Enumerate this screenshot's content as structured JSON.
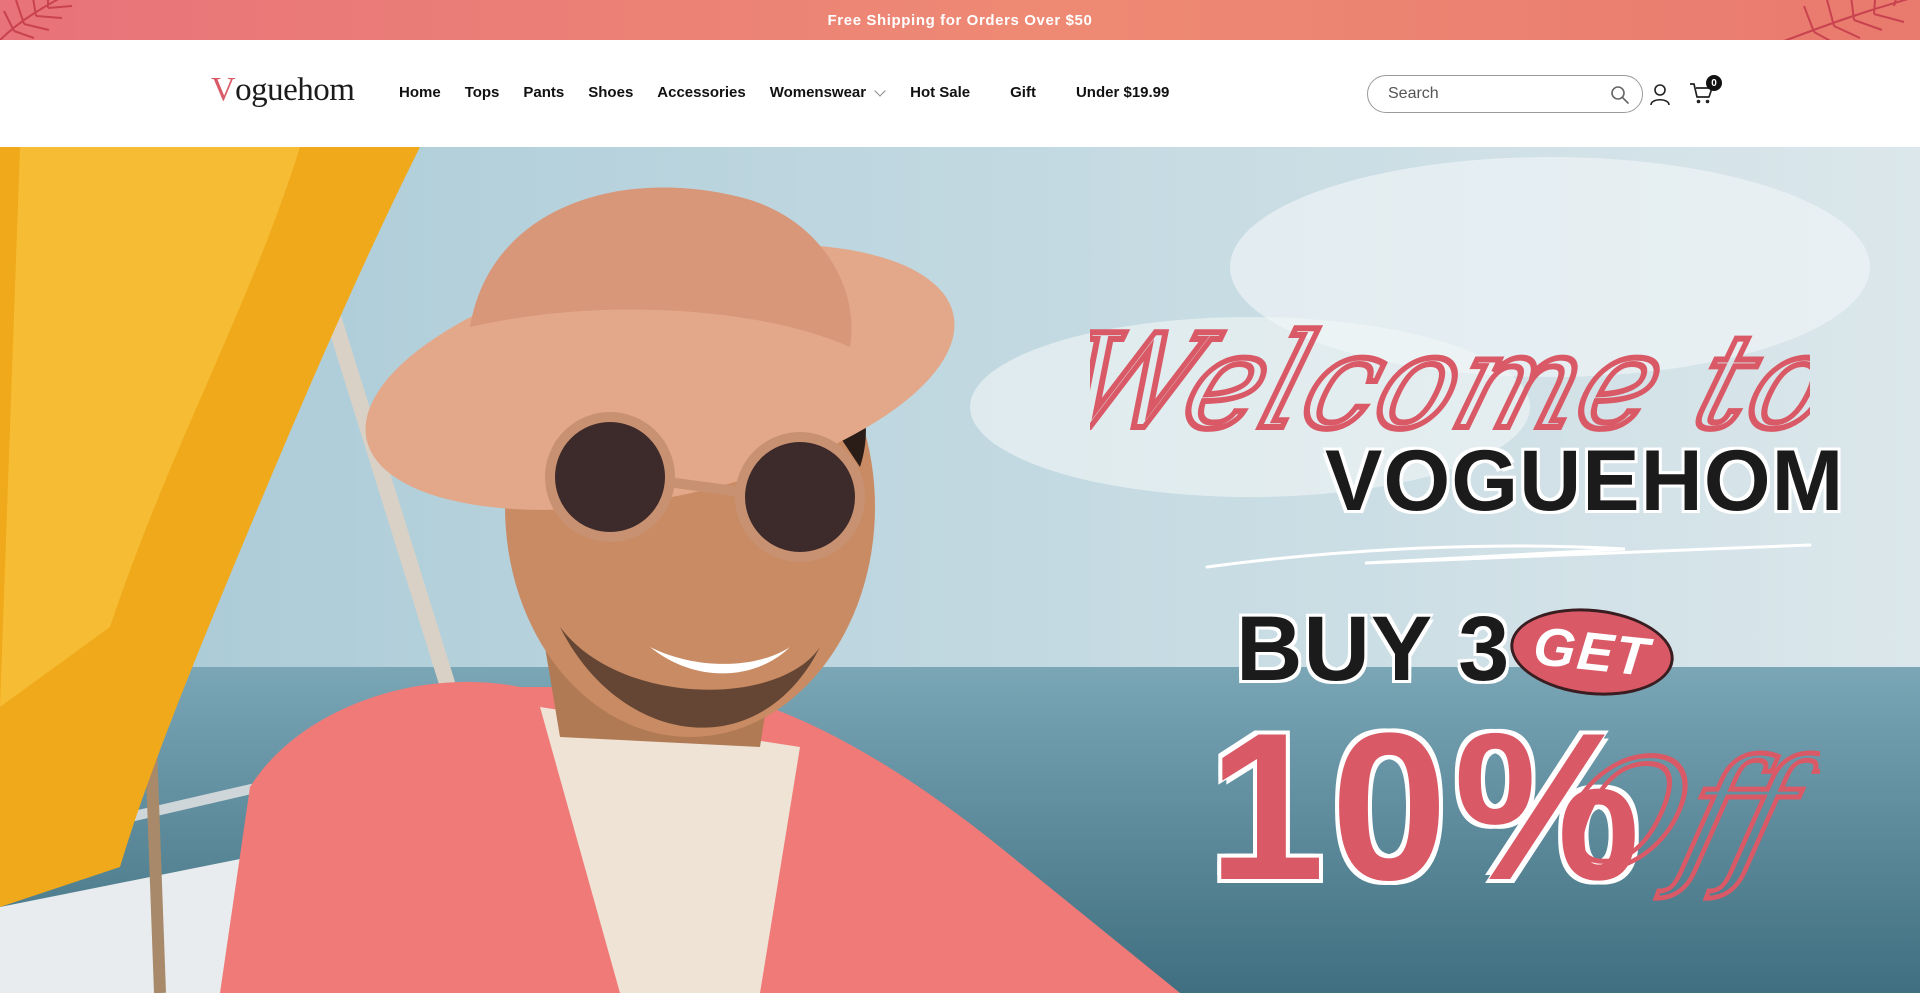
{
  "announcement": {
    "text": "Free Shipping for Orders Over $50"
  },
  "brand": {
    "logo_first": "V",
    "logo_rest": "oguehom"
  },
  "nav": {
    "items": [
      {
        "label": "Home"
      },
      {
        "label": "Tops"
      },
      {
        "label": "Pants"
      },
      {
        "label": "Shoes"
      },
      {
        "label": "Accessories"
      },
      {
        "label": "Womenswear",
        "has_dropdown": true
      },
      {
        "label": "Hot Sale"
      },
      {
        "label": "Gift"
      },
      {
        "label": "Under $19.99"
      }
    ]
  },
  "search": {
    "placeholder": "Search"
  },
  "cart": {
    "count": "0"
  },
  "hero": {
    "welcome": "Welcome to",
    "brand_name": "VOGUEHOM",
    "buy_text": "BUY 3",
    "get_text": "GET",
    "discount": "10%",
    "off_text": "Off"
  },
  "colors": {
    "accent": "#d95a66",
    "announce_start": "#e8737a",
    "announce_end": "#ee8a74",
    "text_dark": "#1b1b1b"
  },
  "icons": [
    "search-icon",
    "account-icon",
    "cart-icon",
    "chevron-down-icon",
    "tropical-leaf-icon"
  ]
}
